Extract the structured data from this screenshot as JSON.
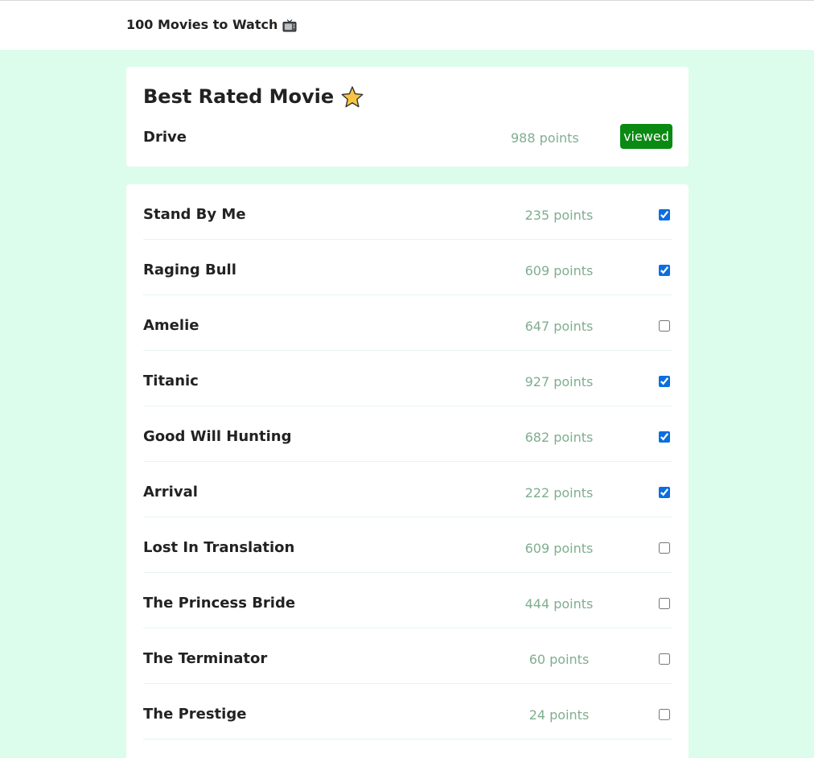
{
  "header": {
    "title": "100 Movies to Watch",
    "icon": "tv-icon"
  },
  "best": {
    "heading": "Best Rated Movie",
    "icon": "star-icon",
    "movie": "Drive",
    "points": "988 points",
    "badge": "viewed",
    "badge_color": "#0a8a12"
  },
  "movies": [
    {
      "title": "Stand By Me",
      "points": "235 points",
      "checked": true
    },
    {
      "title": "Raging Bull",
      "points": "609 points",
      "checked": true
    },
    {
      "title": "Amelie",
      "points": "647 points",
      "checked": false
    },
    {
      "title": "Titanic",
      "points": "927 points",
      "checked": true
    },
    {
      "title": "Good Will Hunting",
      "points": "682 points",
      "checked": true
    },
    {
      "title": "Arrival",
      "points": "222 points",
      "checked": true
    },
    {
      "title": "Lost In Translation",
      "points": "609 points",
      "checked": false
    },
    {
      "title": "The Princess Bride",
      "points": "444 points",
      "checked": false
    },
    {
      "title": "The Terminator",
      "points": "60 points",
      "checked": false
    },
    {
      "title": "The Prestige",
      "points": "24 points",
      "checked": false
    }
  ],
  "colors": {
    "background": "#dcfdec",
    "points_text": "#7fae8f",
    "checkbox_accent": "#0b6ee0"
  }
}
